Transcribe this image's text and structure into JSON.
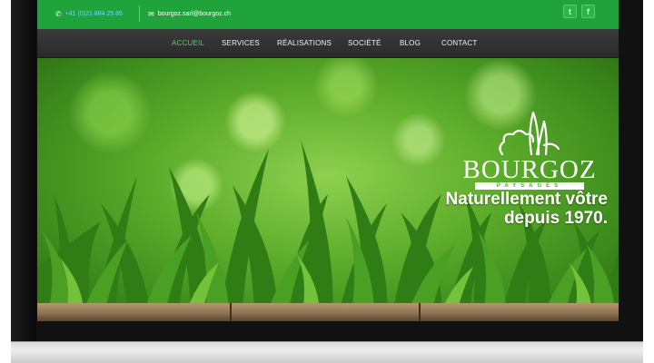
{
  "topbar": {
    "phone": "+41 (0)21 884 25 85",
    "email": "bourgoz.sarl@bourgoz.ch",
    "phone_icon": "phone-icon",
    "email_icon": "envelope-icon",
    "twitter_glyph": "t",
    "facebook_glyph": "f"
  },
  "nav": {
    "items": [
      "ACCUEIL",
      "SERVICES",
      "RÉALISATIONS",
      "SOCIÉTÉ",
      "BLOG",
      "CONTACT"
    ],
    "active_index": 0
  },
  "hero": {
    "logo_name": "BOURGOZ",
    "logo_sub": "PAYSAGES",
    "tagline_line1": "Naturellement vôtre",
    "tagline_line2": "depuis 1970."
  },
  "colors": {
    "brand_green": "#1fa33a",
    "nav_bg": "#2f2f2f",
    "active_nav": "#4fd45f"
  }
}
